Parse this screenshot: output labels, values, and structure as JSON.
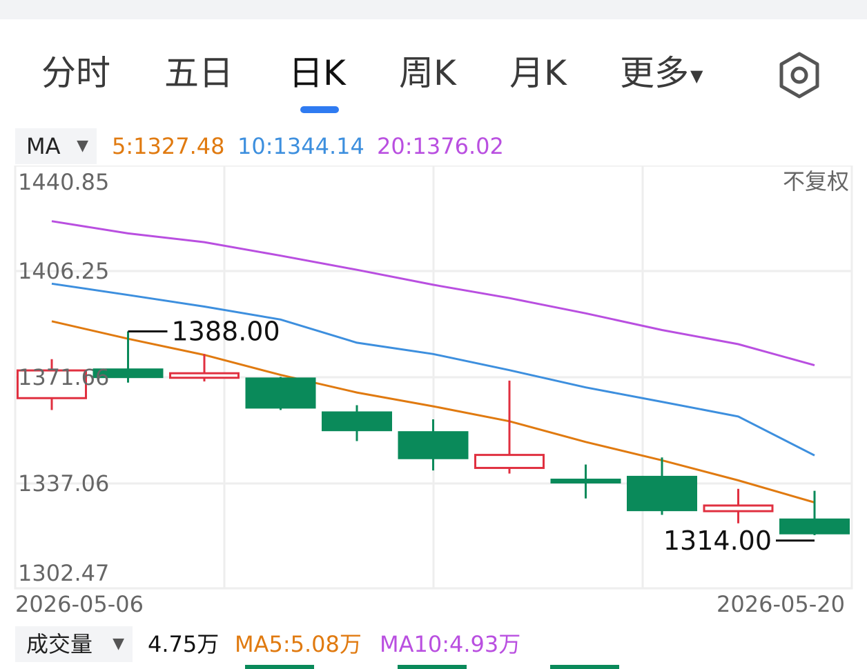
{
  "tabs": [
    {
      "label": "分时",
      "active": false
    },
    {
      "label": "五日",
      "active": false
    },
    {
      "label": "日K",
      "active": true
    },
    {
      "label": "周K",
      "active": false
    },
    {
      "label": "月K",
      "active": false
    },
    {
      "label": "更多",
      "active": false
    }
  ],
  "settings_icon": "hexagon-settings-icon",
  "ma_selector": "MA",
  "ma_legend": [
    {
      "label": "5:1327.48",
      "color": "#e07a10"
    },
    {
      "label": "10:1344.14",
      "color": "#3d8fde"
    },
    {
      "label": "20:1376.02",
      "color": "#b94fe0"
    }
  ],
  "adjust_label": "不复权",
  "volume": {
    "selector": "成交量",
    "value": "4.75万",
    "ma5": "MA5:5.08万",
    "ma10": "MA10:4.93万",
    "ma5_color": "#e07a10",
    "ma10_color": "#b94fe0"
  },
  "colors": {
    "up": "#e03040",
    "down": "#0a8a5a",
    "grid": "#eeeeee",
    "axis_text": "#666666"
  },
  "chart_data": {
    "type": "candlestick",
    "y_ticks": [
      "1440.85",
      "1406.25",
      "1371.66",
      "1337.06",
      "1302.47"
    ],
    "ylim": [
      1302.47,
      1440.85
    ],
    "x_tick_labels": [
      "2026-05-06",
      "2026-05-20"
    ],
    "high_marker": {
      "label": "1388.00",
      "value": 1388.0,
      "index": 1
    },
    "low_marker": {
      "label": "1314.00",
      "value": 1314.0,
      "index": 10
    },
    "candles": [
      {
        "open": 1364.4,
        "close": 1374.2,
        "high": 1378.2,
        "low": 1360.2,
        "up": true
      },
      {
        "open": 1374.9,
        "close": 1371.5,
        "high": 1388.0,
        "low": 1369.9,
        "up": false
      },
      {
        "open": 1371.6,
        "close": 1373.2,
        "high": 1380.0,
        "low": 1370.3,
        "up": true
      },
      {
        "open": 1371.7,
        "close": 1360.7,
        "high": 1371.9,
        "low": 1360.2,
        "up": false
      },
      {
        "open": 1359.7,
        "close": 1352.7,
        "high": 1361.9,
        "low": 1349.2,
        "up": false
      },
      {
        "open": 1352.7,
        "close": 1342.8,
        "high": 1356.9,
        "low": 1338.8,
        "up": false
      },
      {
        "open": 1339.7,
        "close": 1344.3,
        "high": 1370.6,
        "low": 1337.7,
        "up": true
      },
      {
        "open": 1335.9,
        "close": 1334.2,
        "high": 1340.9,
        "low": 1328.9,
        "up": false
      },
      {
        "open": 1336.9,
        "close": 1324.4,
        "high": 1343.4,
        "low": 1323.1,
        "up": false
      },
      {
        "open": 1324.4,
        "close": 1326.4,
        "high": 1332.3,
        "low": 1320.1,
        "up": true
      },
      {
        "open": 1321.8,
        "close": 1316.2,
        "high": 1331.6,
        "low": 1315.9,
        "up": false
      }
    ],
    "series": [
      {
        "name": "5",
        "color": "#e07a10",
        "values": [
          1391.6,
          1385.4,
          1379.7,
          1372.6,
          1366.4,
          1361.5,
          1356.2,
          1348.9,
          1342.4,
          1335.3,
          1327.48
        ]
      },
      {
        "name": "10",
        "color": "#3d8fde",
        "values": [
          1404.9,
          1400.9,
          1396.8,
          1392.2,
          1384.0,
          1380.0,
          1374.3,
          1368.2,
          1363.1,
          1357.9,
          1344.14
        ]
      },
      {
        "name": "20",
        "color": "#b94fe0",
        "values": [
          1427.0,
          1422.7,
          1419.6,
          1414.8,
          1409.8,
          1404.5,
          1399.8,
          1394.4,
          1388.5,
          1383.5,
          1376.02
        ]
      }
    ]
  }
}
